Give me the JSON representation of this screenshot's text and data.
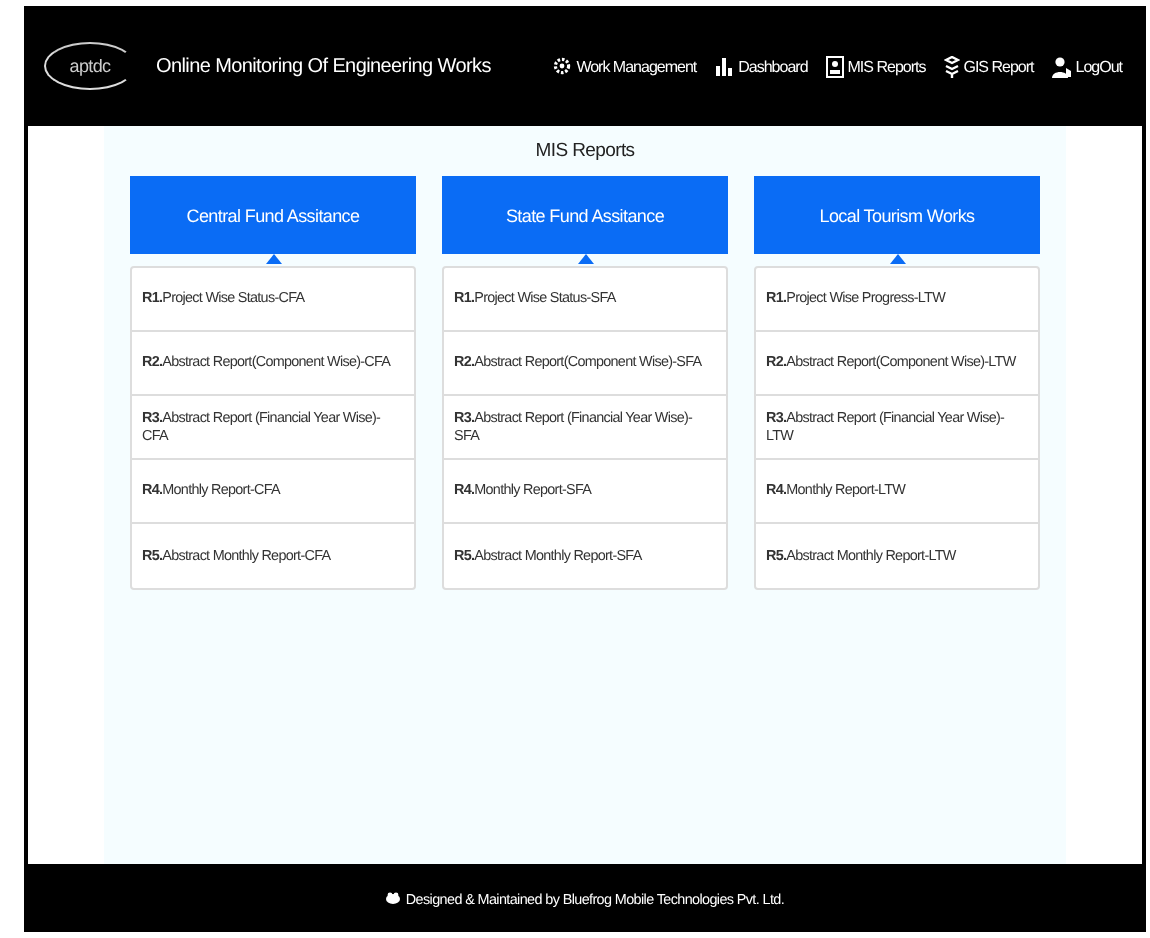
{
  "header": {
    "logo": "aptdc",
    "title": "Online Monitoring Of Engineering Works",
    "nav": [
      {
        "label": "Work Management"
      },
      {
        "label": "Dashboard"
      },
      {
        "label": "MIS Reports"
      },
      {
        "label": "GIS Report"
      },
      {
        "label": "LogOut"
      }
    ]
  },
  "page_title": "MIS Reports",
  "panels": [
    {
      "heading": "Central Fund Assitance",
      "items": [
        "**R1.**Project Wise Status-CFA",
        "**R2.**Abstract Report(Component Wise)-CFA",
        "**R3.**Abstract Report (Financial Year Wise)-CFA",
        "**R4.**Monthly Report-CFA",
        "**R5.**Abstract Monthly Report-CFA"
      ]
    },
    {
      "heading": "State Fund Assitance",
      "items": [
        "**R1.**Project Wise Status-SFA",
        "**R2.**Abstract Report(Component Wise)-SFA",
        "**R3.**Abstract Report (Financial Year Wise)-SFA",
        "**R4.**Monthly Report-SFA",
        "**R5.**Abstract Monthly Report-SFA"
      ]
    },
    {
      "heading": "Local Tourism Works",
      "items": [
        "**R1.**Project Wise Progress-LTW",
        "**R2.**Abstract Report(Component Wise)-LTW",
        "**R3.**Abstract Report (Financial Year Wise)-LTW",
        "**R4.**Monthly Report-LTW",
        "**R5.**Abstract Monthly Report-LTW"
      ]
    }
  ],
  "footer": "Designed & Maintained by Bluefrog Mobile Technologies Pvt. Ltd."
}
